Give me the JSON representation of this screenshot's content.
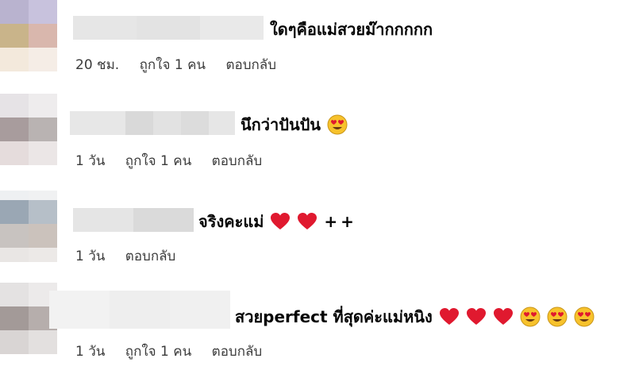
{
  "comments": [
    {
      "text": "ใดๆคือแม่สวยม๊ากกกกก",
      "emojis": [],
      "suffix": "",
      "time": "20 ชม.",
      "likes": "ถูกใจ 1 คน",
      "reply": "ตอบกลับ"
    },
    {
      "text": "นึกว่าปันปัน",
      "emojis": [
        "heart-eyes"
      ],
      "suffix": "",
      "time": "1 วัน",
      "likes": "ถูกใจ 1 คน",
      "reply": "ตอบกลับ"
    },
    {
      "text": "จริงคะแม่",
      "emojis": [
        "heart",
        "heart"
      ],
      "suffix": "++",
      "time": "1 วัน",
      "likes": "",
      "reply": "ตอบกลับ"
    },
    {
      "text": "สวยperfect ที่สุดค่ะแม่หนิง",
      "emojis": [
        "heart",
        "heart",
        "heart",
        "heart-eyes",
        "heart-eyes",
        "heart-eyes"
      ],
      "suffix": "",
      "time": "1 วัน",
      "likes": "ถูกใจ 1 คน",
      "reply": "ตอบกลับ"
    }
  ],
  "colors": {
    "heart": "#e0192f",
    "emoji_face": "#f7c22c",
    "meta_text": "#3b3b3b"
  }
}
